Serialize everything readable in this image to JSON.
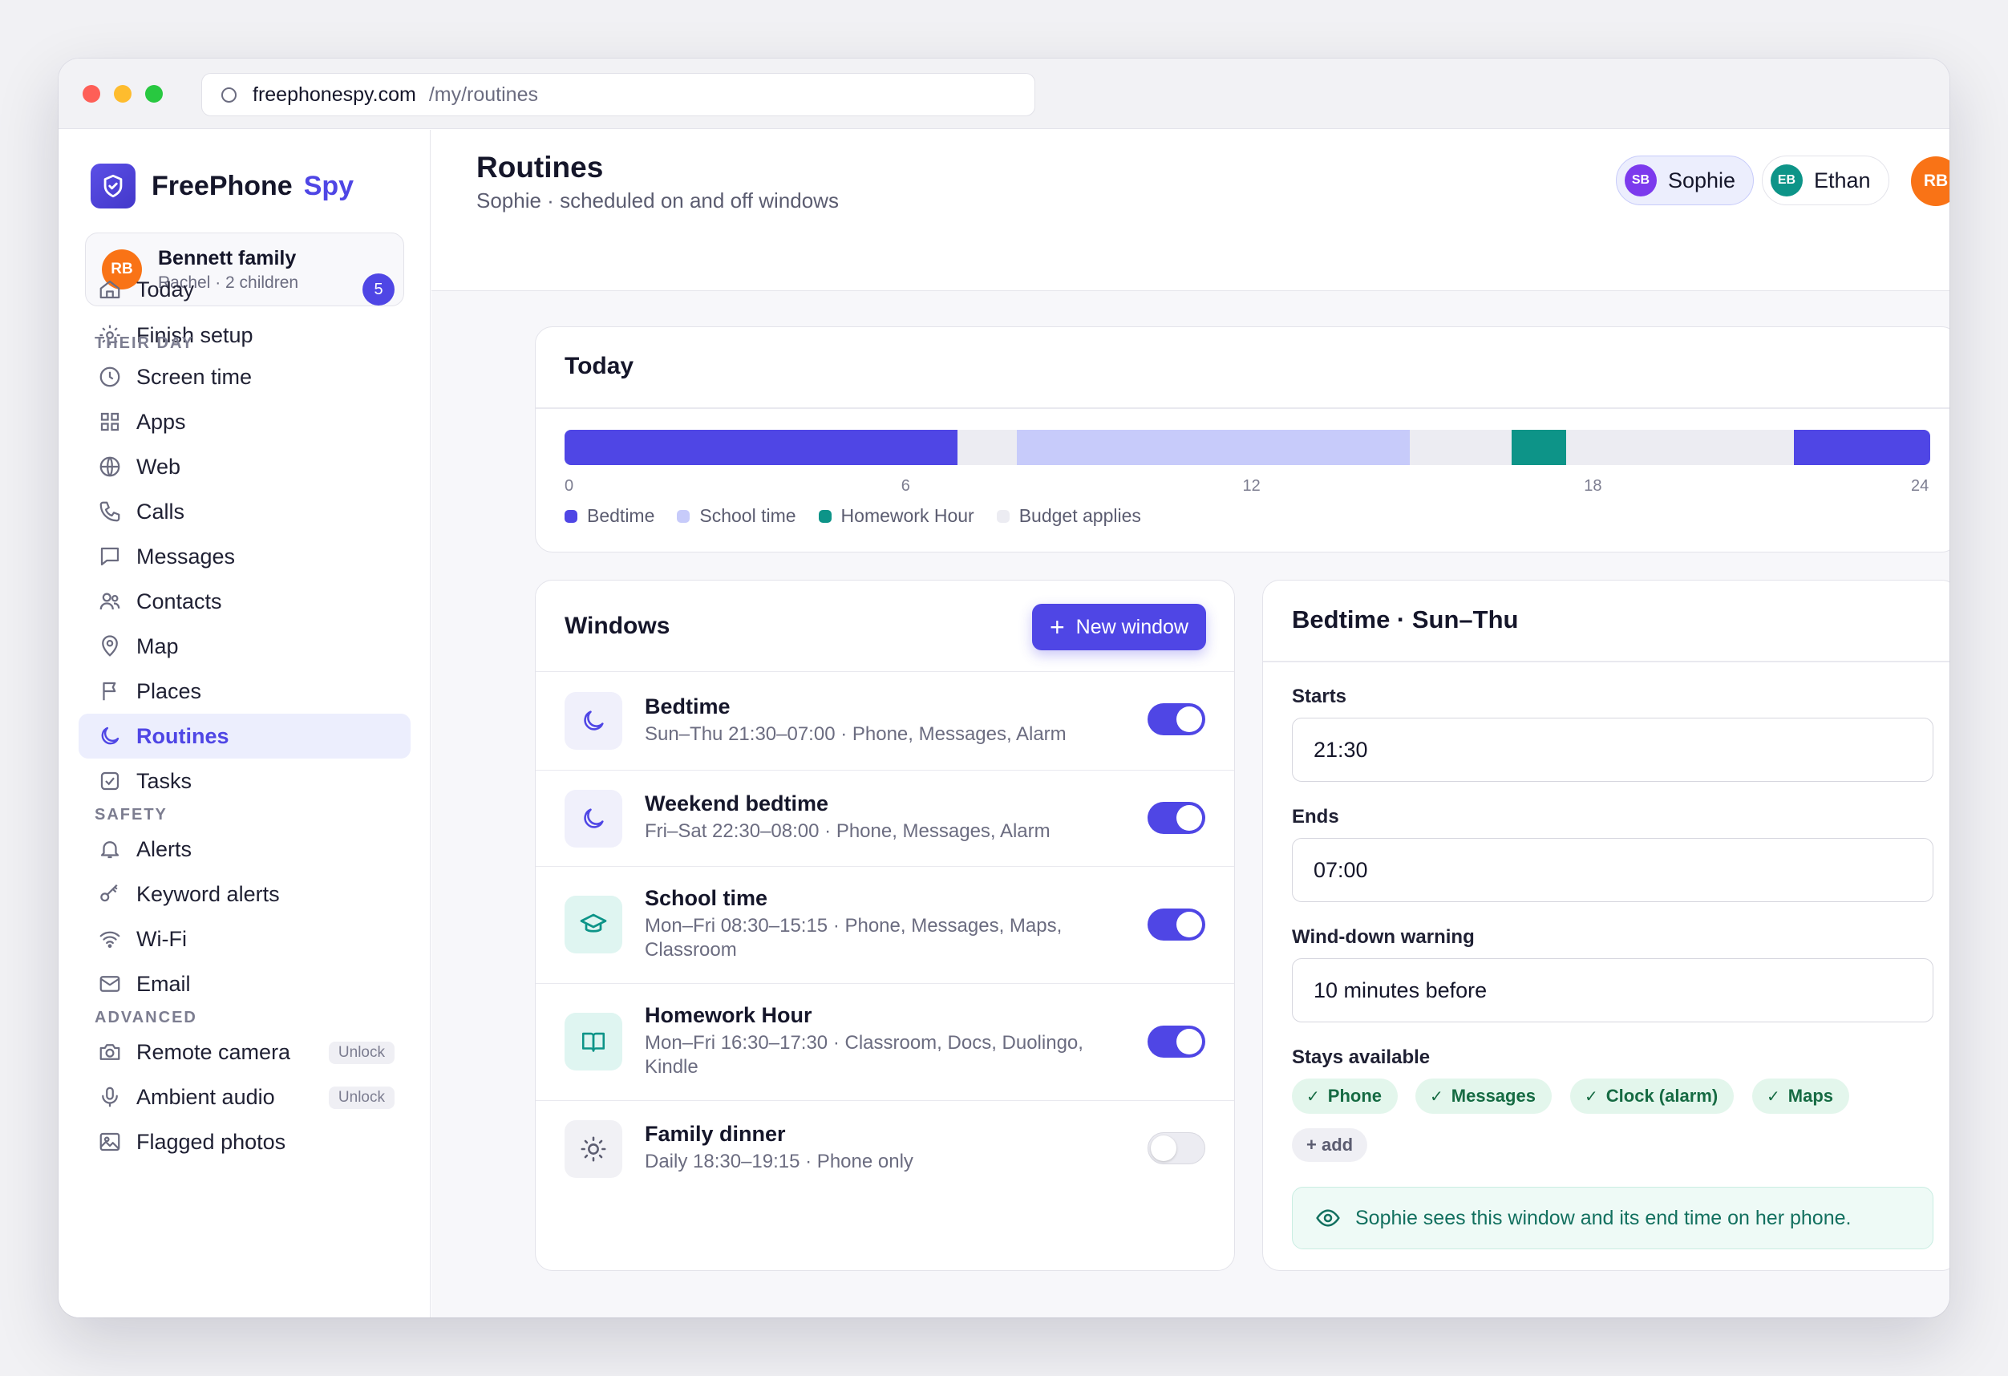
{
  "browser": {
    "host": "freephonespy.com",
    "path": "/my/routines"
  },
  "brand": {
    "name": "FreePhone",
    "accent": "Spy"
  },
  "family": {
    "avatar": "RB",
    "name": "Bennett family",
    "sub": "Rachel · 2 children"
  },
  "nav": {
    "today": "Today",
    "today_badge": "5",
    "finish_setup": "Finish setup",
    "section_their_day": "THEIR DAY",
    "screen_time": "Screen time",
    "apps": "Apps",
    "web": "Web",
    "calls": "Calls",
    "messages": "Messages",
    "contacts": "Contacts",
    "map": "Map",
    "places": "Places",
    "routines": "Routines",
    "tasks": "Tasks",
    "section_safety": "SAFETY",
    "alerts": "Alerts",
    "keyword_alerts": "Keyword alerts",
    "wifi": "Wi-Fi",
    "email": "Email",
    "section_advanced": "ADVANCED",
    "remote_camera": "Remote camera",
    "ambient_audio": "Ambient audio",
    "flagged_photos": "Flagged photos",
    "unlock": "Unlock"
  },
  "header": {
    "title": "Routines",
    "subtitle": "Sophie · scheduled on and off windows",
    "children": [
      {
        "initials": "SB",
        "name": "Sophie",
        "color": "#7c3aed",
        "selected": true
      },
      {
        "initials": "EB",
        "name": "Ethan",
        "color": "#0d9488",
        "selected": false
      }
    ],
    "user_avatar": "RB"
  },
  "today": {
    "title": "Today",
    "hours_range": [
      0,
      24
    ],
    "ticks": [
      "0",
      "6",
      "12",
      "18",
      "24"
    ],
    "segments": [
      {
        "kind": "bedtime",
        "start": 0,
        "end": 6.9
      },
      {
        "kind": "school",
        "start": 7.95,
        "end": 14.85
      },
      {
        "kind": "homework",
        "start": 16.65,
        "end": 17.6
      },
      {
        "kind": "bedtime",
        "start": 21.6,
        "end": 24
      }
    ],
    "legend": [
      {
        "kind": "bedtime",
        "label": "Bedtime",
        "color": "#4f46e5"
      },
      {
        "kind": "school",
        "label": "School time",
        "color": "#c7cbfa"
      },
      {
        "kind": "homework",
        "label": "Homework Hour",
        "color": "#0d9488"
      },
      {
        "kind": "budget",
        "label": "Budget applies",
        "color": "#ececf2"
      }
    ]
  },
  "windows": {
    "title": "Windows",
    "new_button": "New window",
    "items": [
      {
        "name": "Bedtime",
        "detail": "Sun–Thu 21:30–07:00 · Phone, Messages, Alarm",
        "icon": "moon-icon",
        "enabled": true
      },
      {
        "name": "Weekend bedtime",
        "detail": "Fri–Sat 22:30–08:00 · Phone, Messages, Alarm",
        "icon": "moon-icon",
        "enabled": true
      },
      {
        "name": "School time",
        "detail": "Mon–Fri 08:30–15:15 · Phone, Messages, Maps, Classroom",
        "icon": "graduation-cap-icon",
        "enabled": true
      },
      {
        "name": "Homework Hour",
        "detail": "Mon–Fri 16:30–17:30 · Classroom, Docs, Duolingo, Kindle",
        "icon": "book-icon",
        "enabled": true
      },
      {
        "name": "Family dinner",
        "detail": "Daily 18:30–19:15 · Phone only",
        "icon": "sun-icon",
        "enabled": false
      }
    ]
  },
  "detail": {
    "title": "Bedtime · Sun–Thu",
    "starts_label": "Starts",
    "starts_value": "21:30",
    "ends_label": "Ends",
    "ends_value": "07:00",
    "warning_label": "Wind-down warning",
    "warning_value": "10 minutes before",
    "stays_label": "Stays available",
    "stays": [
      "Phone",
      "Messages",
      "Clock (alarm)",
      "Maps"
    ],
    "add_label": "+ add",
    "note": "Sophie sees this window and its end time on her phone."
  }
}
